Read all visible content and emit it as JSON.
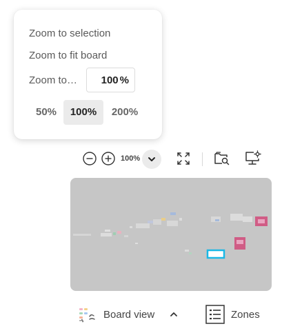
{
  "zoom_menu": {
    "zoom_to_selection": "Zoom to selection",
    "zoom_to_fit": "Zoom to fit board",
    "zoom_to_label": "Zoom to…",
    "zoom_input_value": "100",
    "zoom_input_unit": "%",
    "presets": [
      {
        "label": "50%",
        "active": false
      },
      {
        "label": "100%",
        "active": true
      },
      {
        "label": "200%",
        "active": false
      }
    ]
  },
  "toolbar": {
    "zoom_level": "100%",
    "icons": [
      "zoom-out-icon",
      "zoom-in-icon",
      "chevron-down-icon",
      "fullscreen-icon",
      "folder-search-icon",
      "presentation-settings-icon"
    ]
  },
  "minimap": {
    "viewport_color": "#1ab8e6"
  },
  "bottom_bar": {
    "board_view_label": "Board view",
    "zones_label": "Zones"
  }
}
